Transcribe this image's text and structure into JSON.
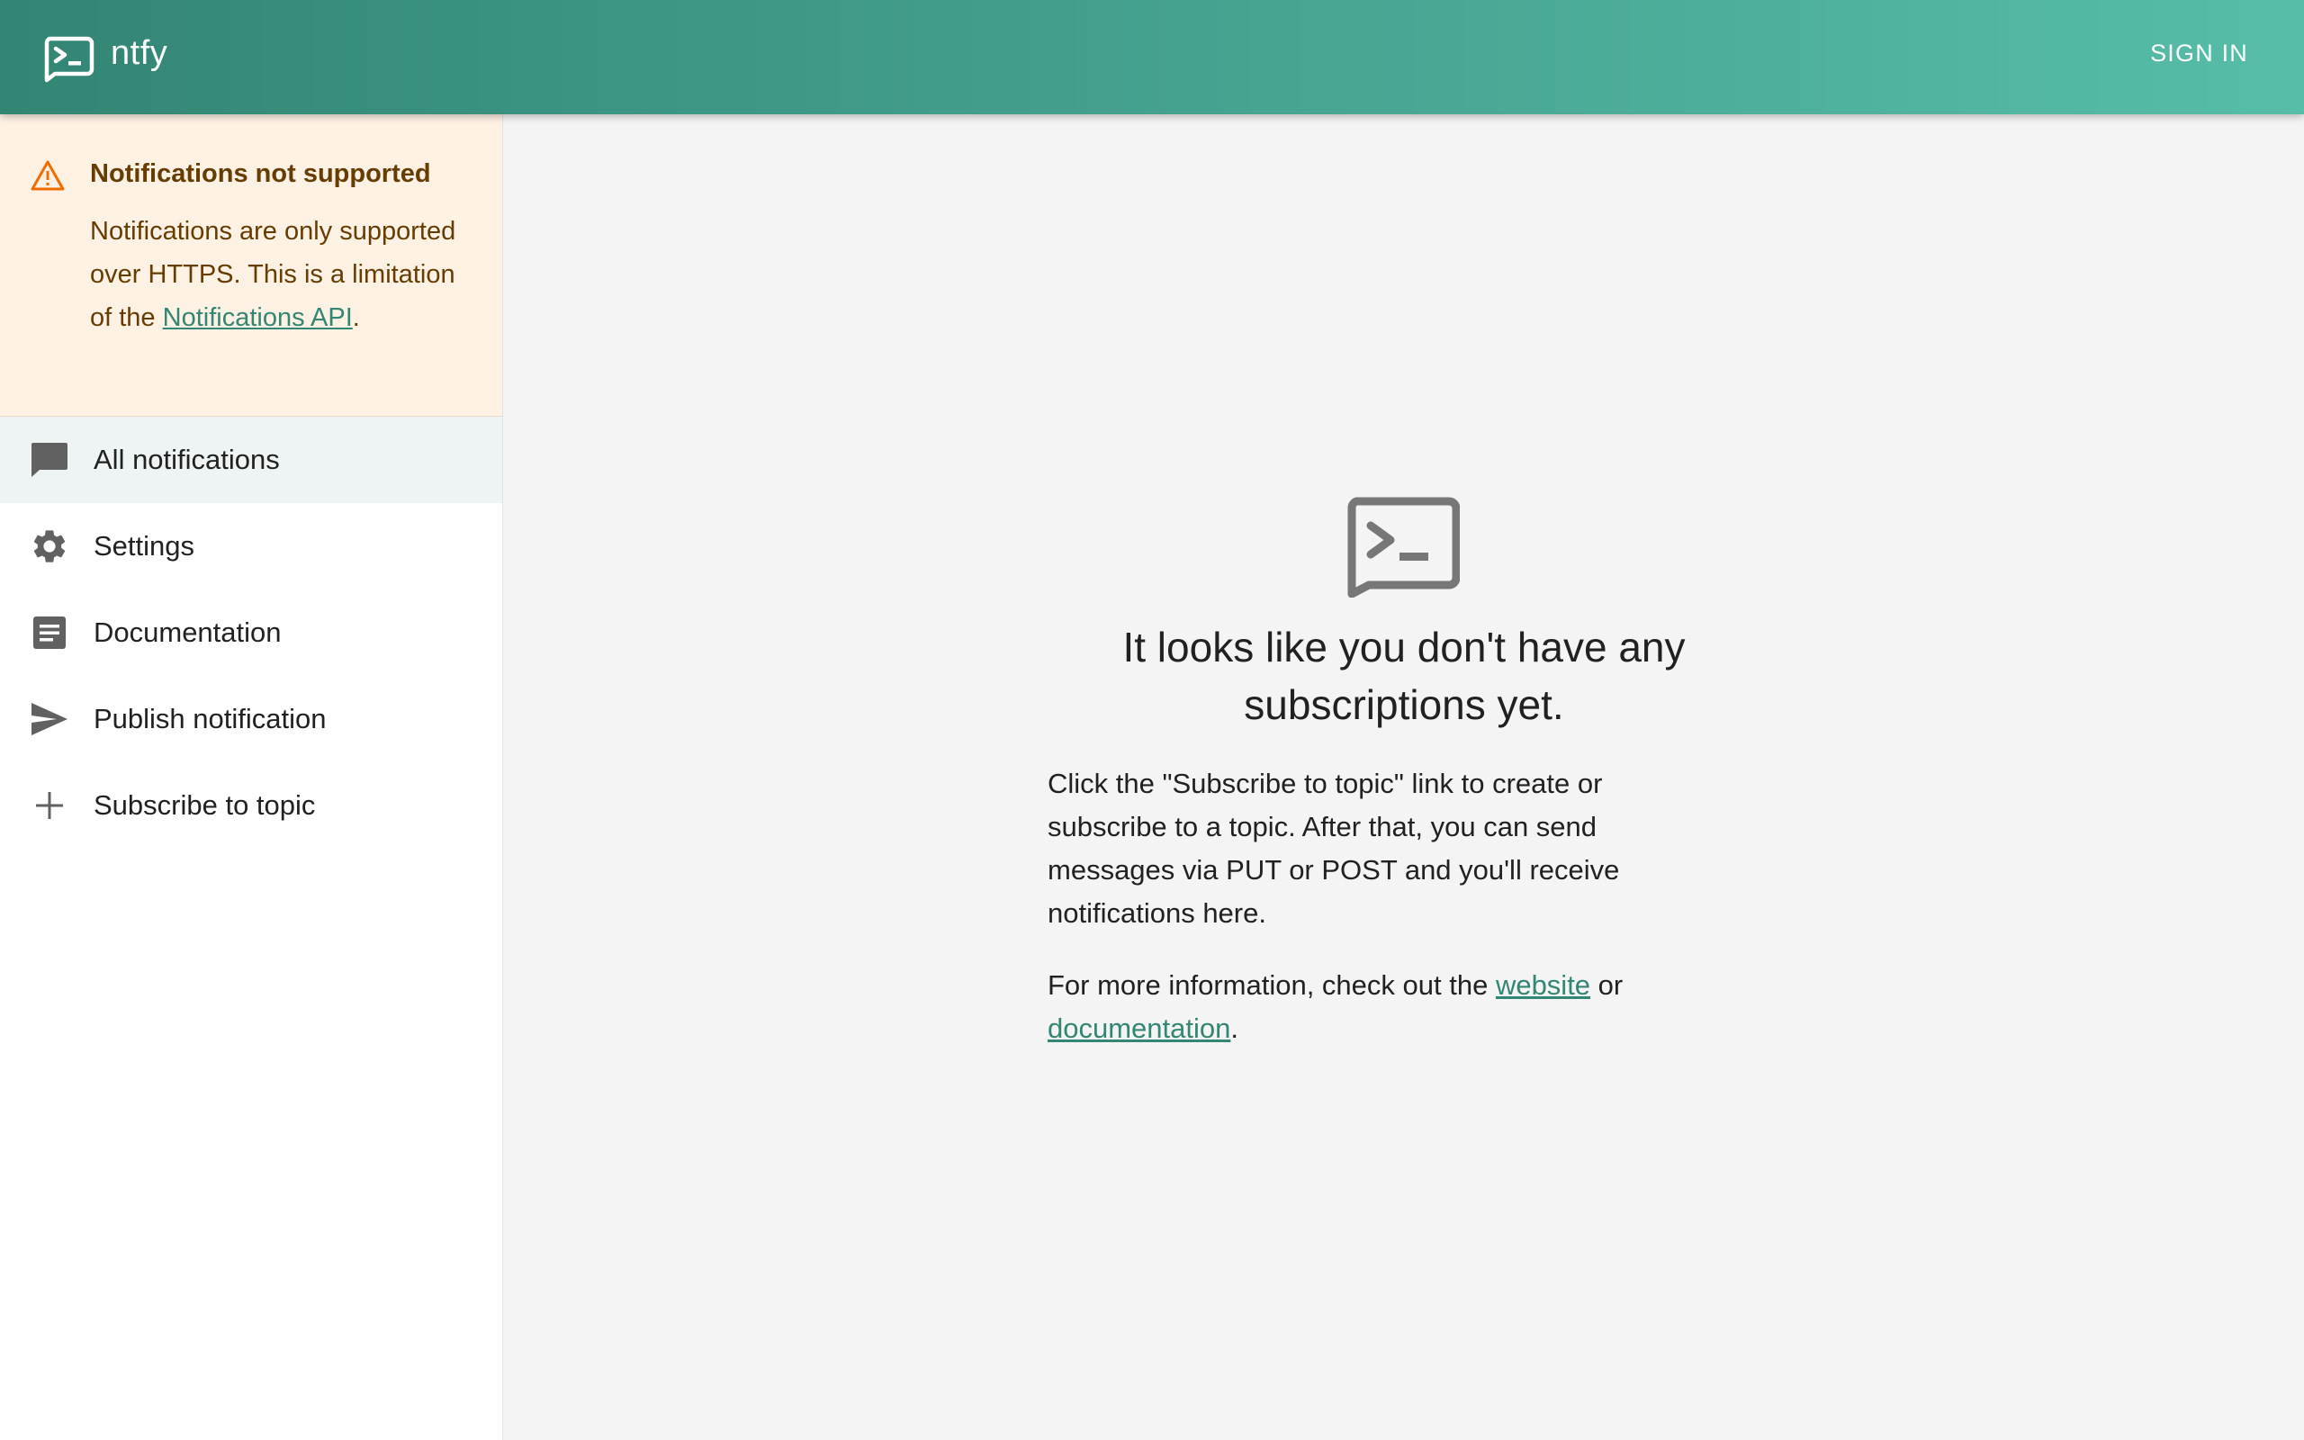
{
  "app": {
    "title": "ntfy",
    "sign_in_label": "SIGN IN",
    "brand_gradient": [
      "#338574",
      "#56bda8"
    ],
    "logo_icon": "terminal-chat-icon"
  },
  "alert": {
    "icon": "warning-icon",
    "title": "Notifications not supported",
    "body_prefix": "Notifications are only supported over HTTPS. This is a limitation of the ",
    "link_text": "Notifications API",
    "body_suffix": ".",
    "text_color": "#663c00",
    "background_color": "#fff2e4"
  },
  "sidebar": {
    "items": [
      {
        "label": "All notifications",
        "icon": "chat-bubble-icon",
        "selected": true
      },
      {
        "label": "Settings",
        "icon": "gear-icon",
        "selected": false
      },
      {
        "label": "Documentation",
        "icon": "document-icon",
        "selected": false
      },
      {
        "label": "Publish notification",
        "icon": "send-icon",
        "selected": false
      },
      {
        "label": "Subscribe to topic",
        "icon": "plus-icon",
        "selected": false
      }
    ]
  },
  "main": {
    "empty_icon": "terminal-chat-icon",
    "title": "It looks like you don't have any subscriptions yet.",
    "paragraph1": "Click the \"Subscribe to topic\" link to create or subscribe to a topic. After that, you can send messages via PUT or POST and you'll receive notifications here.",
    "paragraph2_prefix": "For more information, check out the ",
    "website_link": "website",
    "paragraph2_middle": " or ",
    "documentation_link": "documentation",
    "paragraph2_suffix": "."
  }
}
